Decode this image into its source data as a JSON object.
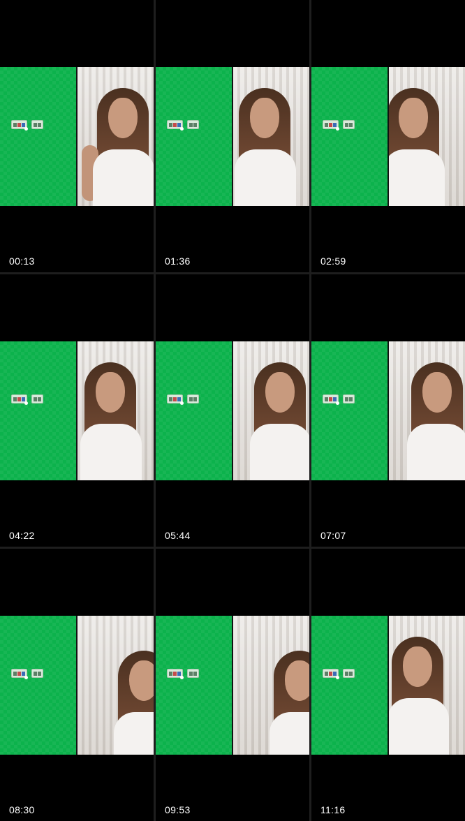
{
  "thumbnails": [
    {
      "timestamp": "00:13"
    },
    {
      "timestamp": "01:36"
    },
    {
      "timestamp": "02:59"
    },
    {
      "timestamp": "04:22"
    },
    {
      "timestamp": "05:44"
    },
    {
      "timestamp": "07:07"
    },
    {
      "timestamp": "08:30"
    },
    {
      "timestamp": "09:53"
    },
    {
      "timestamp": "11:16"
    }
  ],
  "colors": {
    "background": "#000000",
    "green_screen": "#0cb24c",
    "text": "#ffffff"
  }
}
